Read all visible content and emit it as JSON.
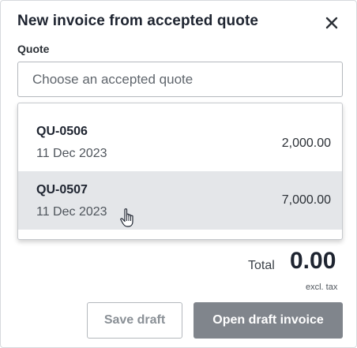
{
  "dialog": {
    "title": "New invoice from accepted quote",
    "close_icon": "close-icon"
  },
  "quote_field": {
    "label": "Quote",
    "placeholder": "Choose an accepted quote"
  },
  "quote_options": [
    {
      "code": "QU-0506",
      "date": "11 Dec 2023",
      "amount": "2,000.00",
      "hovered": false
    },
    {
      "code": "QU-0507",
      "date": "11 Dec 2023",
      "amount": "7,000.00",
      "hovered": true
    }
  ],
  "summary": {
    "total_label": "Total",
    "total_value": "0.00",
    "tax_note": "excl. tax"
  },
  "actions": {
    "save_draft": "Save draft",
    "open_draft_invoice": "Open draft invoice"
  },
  "colors": {
    "hover_row": "#e4e6e9",
    "primary_button_disabled": "#80858c",
    "text": "#1e2430"
  },
  "cursor": "hand-pointer-cursor"
}
